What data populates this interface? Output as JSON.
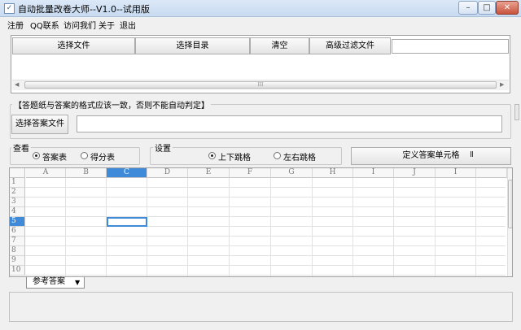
{
  "window": {
    "title": "自动批量改卷大师--V1.0--试用版",
    "icon": "✓",
    "minimize": "–",
    "maximize": "□",
    "close": "✕"
  },
  "menu": [
    "注册",
    "QQ联系",
    "访问我们",
    "关于",
    "退出"
  ],
  "filePanel": {
    "buttons": [
      "选择文件",
      "选择目录",
      "清空",
      "高级过滤文件"
    ],
    "filterInput": "",
    "scrollGrip": "⁞⁞⁞"
  },
  "answerGroup": {
    "title": "【答题纸与答案的格式应该一致，否则不能自动判定】",
    "button": "选择答案文件",
    "pathInput": ""
  },
  "viewGroup": {
    "title": "查看",
    "options": [
      "答案表",
      "得分表"
    ],
    "selected": 0
  },
  "settingsGroup": {
    "title": "设置",
    "options": [
      "上下跳格",
      "左右跳格"
    ],
    "selected": 0
  },
  "defineButton": {
    "label": "定义答案单元格",
    "suffix": "Ⅱ"
  },
  "sheet": {
    "columns": [
      "A",
      "B",
      "C",
      "D",
      "E",
      "F",
      "G",
      "H",
      "I",
      "J",
      "I"
    ],
    "selectedColumn": 2,
    "rows": [
      "1",
      "2",
      "3",
      "4",
      "5",
      "6",
      "7",
      "8",
      "9",
      "10"
    ],
    "selectedRow": 4
  },
  "sheetTab": {
    "label": "参考答案",
    "arrow": "▼"
  },
  "statusBar": ""
}
